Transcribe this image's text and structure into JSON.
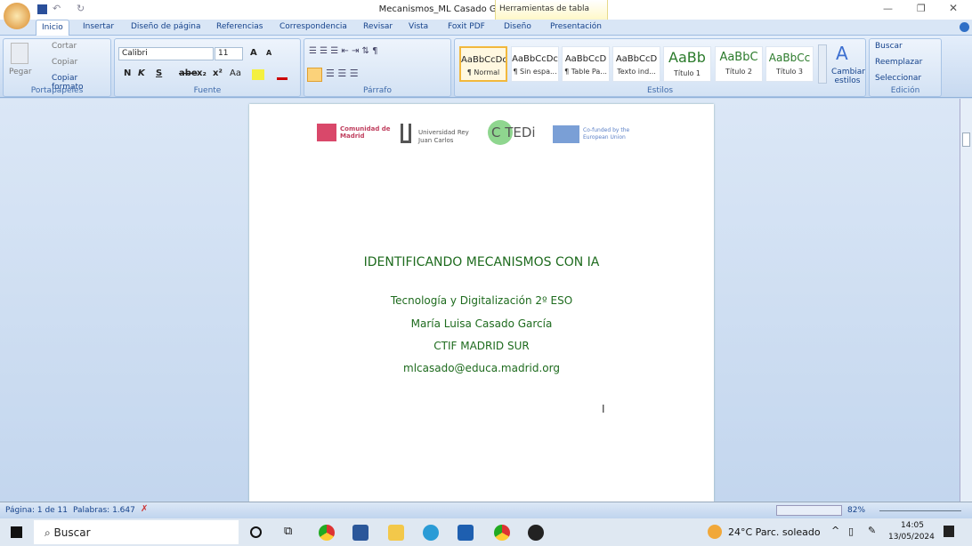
{
  "window": {
    "title": "Mecanismos_ML Casado García - Microsoft Word",
    "context_tab": "Herramientas de tabla"
  },
  "tabs": [
    "Inicio",
    "Insertar",
    "Diseño de página",
    "Referencias",
    "Correspondencia",
    "Revisar",
    "Vista",
    "Foxit PDF",
    "Diseño",
    "Presentación"
  ],
  "clipboard": {
    "paste": "Pegar",
    "cut": "Cortar",
    "copy": "Copiar",
    "format_painter": "Copiar formato",
    "label": "Portapapeles"
  },
  "font": {
    "name": "Calibri",
    "size": "11",
    "label": "Fuente",
    "bold": "N",
    "italic": "K",
    "underline": "S",
    "strike": "abe",
    "sub": "x₂",
    "sup": "x²",
    "case": "Aa"
  },
  "paragraph": {
    "label": "Párrafo"
  },
  "styles": {
    "items": [
      {
        "preview": "AaBbCcDc",
        "name": "¶ Normal"
      },
      {
        "preview": "AaBbCcDc",
        "name": "¶ Sin espa..."
      },
      {
        "preview": "AaBbCcD",
        "name": "¶ Table Pa..."
      },
      {
        "preview": "AaBbCcD",
        "name": "Texto ind..."
      },
      {
        "preview": "AaBb",
        "name": "Título 1"
      },
      {
        "preview": "AaBbC",
        "name": "Título 2"
      },
      {
        "preview": "AaBbCc",
        "name": "Título 3"
      }
    ],
    "change": "Cambiar estilos",
    "label": "Estilos"
  },
  "editing": {
    "find": "Buscar",
    "replace": "Reemplazar",
    "select": "Seleccionar",
    "label": "Edición"
  },
  "document": {
    "logos": [
      "Comunidad de Madrid",
      "Universidad Rey Juan Carlos",
      "COTEDi",
      "Co-funded by the European Union"
    ],
    "title": "IDENTIFICANDO MECANISMOS CON IA",
    "lines": [
      "Tecnología y Digitalización 2º ESO",
      "María Luisa Casado García",
      "CTIF MADRID SUR",
      "mlcasado@educa.madrid.org"
    ]
  },
  "status": {
    "page": "Página: 1 de 11",
    "words": "Palabras: 1.647",
    "zoom": "82%"
  },
  "taskbar": {
    "search": "Buscar",
    "weather": "24°C  Parc. soleado",
    "time": "14:05",
    "date": "13/05/2024"
  }
}
